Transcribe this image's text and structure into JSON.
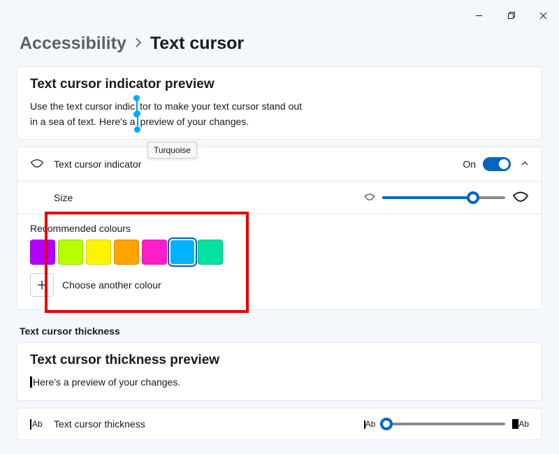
{
  "window_controls": {
    "minimize": "minimize",
    "restore": "restore",
    "close": "close"
  },
  "breadcrumb": {
    "parent": "Accessibility",
    "current": "Text cursor"
  },
  "preview_card": {
    "title": "Text cursor indicator preview",
    "line1a": "Use the text cursor indic",
    "line1b": "tor to make your text cursor stand out",
    "line2a": "in a sea of text. Here's a",
    "line2b": "preview of your changes."
  },
  "indicator_row": {
    "label": "Text cursor indicator",
    "state": "On"
  },
  "size_row": {
    "label": "Size",
    "slider_fill_pct": 74
  },
  "colours": {
    "heading": "Recommended colours",
    "tooltip": "Turquoise",
    "swatches": [
      {
        "name": "purple",
        "hex": "#B400FF"
      },
      {
        "name": "lime",
        "hex": "#B7FF00"
      },
      {
        "name": "yellow",
        "hex": "#FFF400"
      },
      {
        "name": "orange",
        "hex": "#FFA300"
      },
      {
        "name": "magenta",
        "hex": "#FF1EC8"
      },
      {
        "name": "turquoise",
        "hex": "#00B2FF",
        "selected": true
      },
      {
        "name": "aqua",
        "hex": "#05E2A0"
      }
    ],
    "choose_label": "Choose another colour"
  },
  "thickness_heading": "Text cursor thickness",
  "thickness_preview": {
    "title": "Text cursor thickness preview",
    "text": "Here's a preview of your changes."
  },
  "thickness_row": {
    "label": "Text cursor thickness",
    "small_sample": "Ab",
    "big_sample": "Ab"
  }
}
